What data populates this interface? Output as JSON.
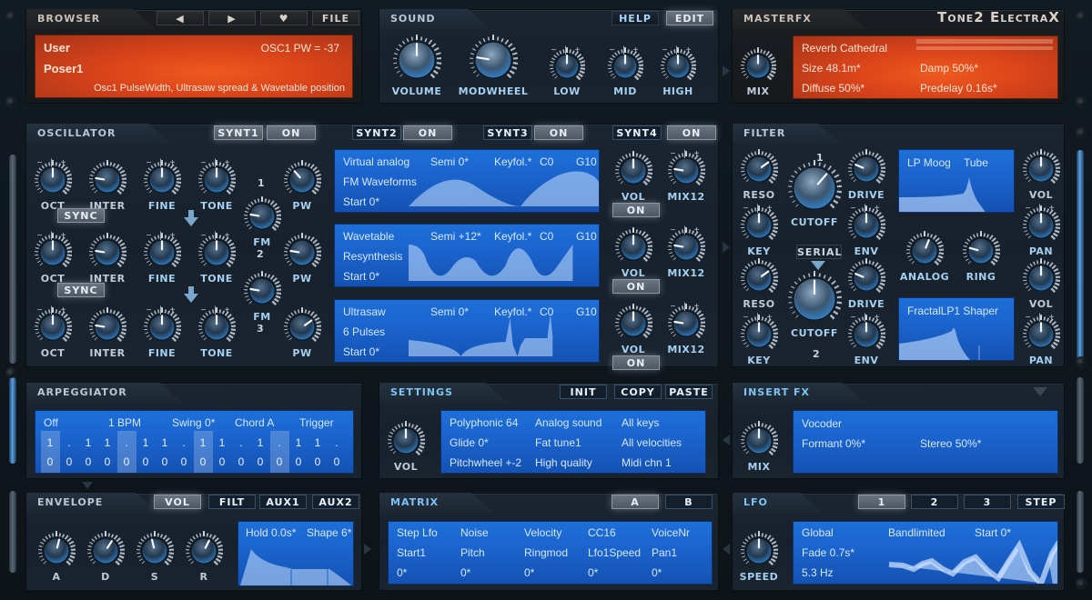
{
  "brand": "Tone2 ElectraX",
  "browser": {
    "title": "BROWSER",
    "buttons": {
      "prev": "◀",
      "next": "▶",
      "favorite": "♥",
      "file": "FILE"
    },
    "bank": "User",
    "preset": "Poser1",
    "param_readout": "OSC1 PW = -37",
    "description": "Osc1 PulseWidth, Ultrasaw spread & Wavetable position"
  },
  "sound": {
    "title": "SOUND",
    "help": "HELP",
    "edit": "EDIT",
    "knobs": [
      {
        "label": "VOLUME",
        "value": 0.5
      },
      {
        "label": "MODWHEEL",
        "value": 0.2
      },
      {
        "label": "LOW",
        "value": 0.5
      },
      {
        "label": "MID",
        "value": 0.5
      },
      {
        "label": "HIGH",
        "value": 0.5
      }
    ]
  },
  "masterfx": {
    "title": "MASTERFX",
    "mix_label": "MIX",
    "mix_value": 0.5,
    "effect": "Reverb Cathedral",
    "params": [
      "Size 48.1m*",
      "Damp 50%*",
      "Diffuse 50%*",
      "Predelay 0.16s*"
    ]
  },
  "oscillator": {
    "title": "OSCILLATOR",
    "synths": [
      {
        "label": "SYNT1",
        "state": "ON"
      },
      {
        "label": "SYNT2",
        "state": "ON"
      },
      {
        "label": "SYNT3",
        "state": "ON"
      },
      {
        "label": "SYNT4",
        "state": "ON"
      }
    ],
    "sync_label": "SYNC",
    "rows": [
      {
        "oct": 0.5,
        "inter": 0.2,
        "fine": 0.5,
        "tone": 0.5,
        "pw": 0.35
      },
      {
        "oct": 0.5,
        "inter": 0.2,
        "fine": 0.5,
        "tone": 0.5,
        "pw": 0.2
      },
      {
        "oct": 0.5,
        "inter": 0.2,
        "fine": 0.5,
        "tone": 0.5,
        "pw": 0.7
      }
    ],
    "knob_labels": {
      "oct": "OCT",
      "inter": "INTER",
      "fine": "FINE",
      "tone": "TONE",
      "pw": "PW",
      "fm": "FM",
      "vol": "VOL",
      "mix12": "MIX12"
    },
    "fm": [
      {
        "top": "1",
        "bottom": "2",
        "value": 0.2
      },
      {
        "top": "",
        "bottom": "3",
        "value": 0.2
      }
    ],
    "displays": [
      {
        "type": "Virtual analog",
        "sub": "FM Waveforms",
        "start": "Start 0*",
        "semi": "Semi 0*",
        "keyfol": "Keyfol.*",
        "low": "C0",
        "high": "G10"
      },
      {
        "type": "Wavetable",
        "sub": "Resynthesis",
        "start": "Start 0*",
        "semi": "Semi +12*",
        "keyfol": "Keyfol.*",
        "low": "C0",
        "high": "G10"
      },
      {
        "type": "Ultrasaw",
        "sub": "6 Pulses",
        "start": "Start 0*",
        "semi": "Semi 0*",
        "keyfol": "Keyfol.*",
        "low": "C0",
        "high": "G10"
      }
    ],
    "voice_on": [
      "ON",
      "ON",
      "ON"
    ]
  },
  "filter": {
    "title": "FILTER",
    "routing": "SERIAL",
    "filter1": {
      "type": "LP Moog",
      "mode": "Tube",
      "number": "1"
    },
    "filter2": {
      "type": "FractalLP1 Shaper",
      "number": "2"
    },
    "labels": {
      "reso": "RESO",
      "key": "KEY",
      "cutoff": "CUTOFF",
      "drive": "DRIVE",
      "env": "ENV",
      "vol": "VOL",
      "pan": "PAN",
      "analog": "ANALOG",
      "ring": "RING"
    }
  },
  "arpeggiator": {
    "title": "ARPEGGIATOR",
    "header": [
      "Off",
      "1 BPM",
      "Swing 0*",
      "Chord A",
      "Trigger"
    ],
    "row1": [
      "1",
      ".",
      "1",
      "1",
      ".",
      "1",
      "1",
      ".",
      "1",
      "1",
      ".",
      "1",
      ".",
      "1",
      "1",
      "."
    ],
    "row2": [
      "0",
      "0",
      "0",
      "0",
      "0",
      "0",
      "0",
      "0",
      "0",
      "0",
      "0",
      "0",
      "0",
      "0",
      "0",
      "0"
    ]
  },
  "settings": {
    "title": "SETTINGS",
    "buttons": {
      "init": "INIT",
      "copy": "COPY",
      "paste": "PASTE"
    },
    "vol_label": "VOL",
    "cells": [
      [
        "Polyphonic 64",
        "Analog sound",
        "All keys"
      ],
      [
        "Glide 0*",
        "Fat tune1",
        "All velocities"
      ],
      [
        "Pitchwheel +-2",
        "High quality",
        "Midi chn 1"
      ]
    ]
  },
  "insertfx": {
    "title": "INSERT FX",
    "mix_label": "MIX",
    "effect": "Vocoder",
    "params": [
      "Formant 0%*",
      "Stereo 50%*"
    ]
  },
  "envelope": {
    "title": "ENVELOPE",
    "tabs": [
      {
        "label": "VOL",
        "active": true
      },
      {
        "label": "FILT",
        "active": false
      },
      {
        "label": "AUX1",
        "active": false
      },
      {
        "label": "AUX2",
        "active": false
      }
    ],
    "knobs": [
      {
        "label": "A",
        "value": 0.55
      },
      {
        "label": "D",
        "value": 0.62
      },
      {
        "label": "S",
        "value": 0.45
      },
      {
        "label": "R",
        "value": 0.6
      }
    ],
    "hold": "Hold 0.0s*",
    "shape": "Shape 6*"
  },
  "matrix": {
    "title": "MATRIX",
    "tabs": [
      {
        "label": "A",
        "active": true
      },
      {
        "label": "B",
        "active": false
      }
    ],
    "slots": [
      {
        "source": "Step Lfo",
        "target": "Start1",
        "amount": "0*"
      },
      {
        "source": "Noise",
        "target": "Pitch",
        "amount": "0*"
      },
      {
        "source": "Velocity",
        "target": "Ringmod",
        "amount": "0*"
      },
      {
        "source": "CC16",
        "target": "Lfo1Speed",
        "amount": "0*"
      },
      {
        "source": "VoiceNr",
        "target": "Pan1",
        "amount": "0*"
      }
    ]
  },
  "lfo": {
    "title": "LFO",
    "tabs": [
      {
        "label": "1",
        "active": true
      },
      {
        "label": "2",
        "active": false
      },
      {
        "label": "3",
        "active": false
      },
      {
        "label": "STEP",
        "active": false
      }
    ],
    "speed_label": "SPEED",
    "mode": "Global",
    "fade": "Fade 0.7s*",
    "rate": "5.3 Hz",
    "waveform": "Bandlimited",
    "start": "Start 0*"
  }
}
